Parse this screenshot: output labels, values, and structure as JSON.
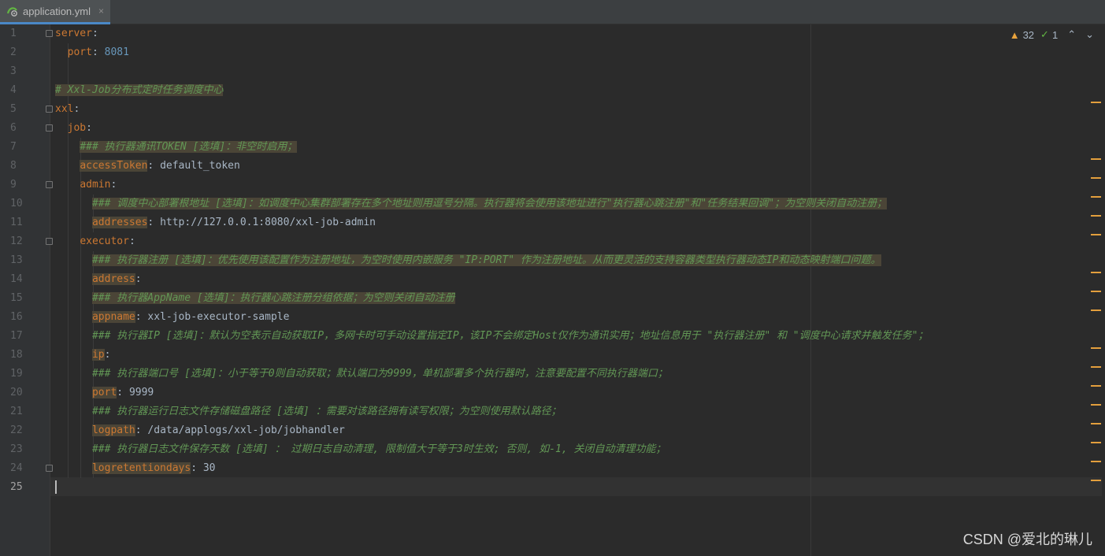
{
  "tab": {
    "filename": "application.yml",
    "close_glyph": "×"
  },
  "inspection": {
    "warnings": "32",
    "checks": "1",
    "prev_glyph": "⌃",
    "next_glyph": "⌄"
  },
  "line_numbers": [
    "1",
    "2",
    "3",
    "4",
    "5",
    "6",
    "7",
    "8",
    "9",
    "10",
    "11",
    "12",
    "13",
    "14",
    "15",
    "16",
    "17",
    "18",
    "19",
    "20",
    "21",
    "22",
    "23",
    "24",
    "25"
  ],
  "code": {
    "l1": {
      "key": "server",
      "sep": ":"
    },
    "l2": {
      "key": "port",
      "sep": ": ",
      "value": "8081"
    },
    "l4": {
      "comment_latin": "# Xxl-Job",
      "comment_cjk": "分布式定时任务调度中心"
    },
    "l5": {
      "key": "xxl",
      "sep": ":"
    },
    "l6": {
      "key": "job",
      "sep": ":"
    },
    "l7": {
      "comment": "### 执行器通讯TOKEN [选填]：非空时启用；"
    },
    "l8": {
      "key": "accessToken",
      "sep": ": ",
      "value": "default_token"
    },
    "l9": {
      "key": "admin",
      "sep": ":"
    },
    "l10": {
      "comment": "### 调度中心部署根地址 [选填]：如调度中心集群部署存在多个地址则用逗号分隔。执行器将会使用该地址进行\"执行器心跳注册\"和\"任务结果回调\"；为空则关闭自动注册；"
    },
    "l11": {
      "key": "addresses",
      "sep": ": ",
      "value": "http://127.0.0.1:8080/xxl-job-admin"
    },
    "l12": {
      "key": "executor",
      "sep": ":"
    },
    "l13": {
      "comment": "### 执行器注册 [选填]：优先使用该配置作为注册地址，为空时使用内嵌服务 \"IP:PORT\" 作为注册地址。从而更灵活的支持容器类型执行器动态IP和动态映射端口问题。"
    },
    "l14": {
      "key": "address",
      "sep": ":"
    },
    "l15": {
      "comment": "### 执行器AppName [选填]：执行器心跳注册分组依据；为空则关闭自动注册"
    },
    "l16": {
      "key": "appname",
      "sep": ": ",
      "value": "xxl-job-executor-sample"
    },
    "l17": {
      "comment": "### 执行器IP [选填]：默认为空表示自动获取IP，多网卡时可手动设置指定IP，该IP不会绑定Host仅作为通讯实用；地址信息用于 \"执行器注册\" 和 \"调度中心请求并触发任务\"；"
    },
    "l18": {
      "key": "ip",
      "sep": ":"
    },
    "l19": {
      "comment": "### 执行器端口号 [选填]：小于等于0则自动获取；默认端口为9999，单机部署多个执行器时，注意要配置不同执行器端口；"
    },
    "l20": {
      "key": "port",
      "sep": ": ",
      "value": "9999"
    },
    "l21": {
      "comment": "### 执行器运行日志文件存储磁盘路径 [选填] ：需要对该路径拥有读写权限；为空则使用默认路径；"
    },
    "l22": {
      "key": "logpath",
      "sep": ": ",
      "value": "/data/applogs/xxl-job/jobhandler"
    },
    "l23": {
      "comment": "### 执行器日志文件保存天数 [选填] ： 过期日志自动清理, 限制值大于等于3时生效; 否则, 如-1, 关闭自动清理功能；"
    },
    "l24": {
      "key": "logretentiondays",
      "sep": ": ",
      "value": "30"
    }
  },
  "watermark": "CSDN @爱北的琳儿",
  "colors": {
    "key": "#cc7832",
    "comment": "#629755",
    "number": "#6897bb",
    "text": "#a9b7c6",
    "warning": "#e8a33d"
  }
}
